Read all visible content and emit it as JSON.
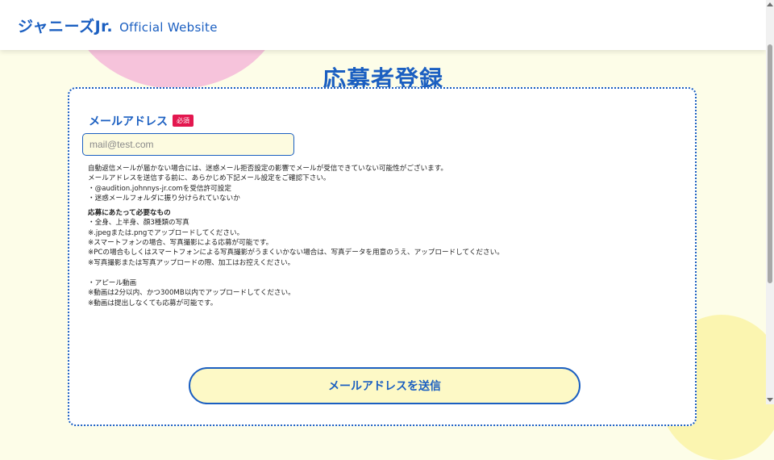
{
  "header": {
    "logo_main": "ジャニーズJr.",
    "logo_sub": "Official Website"
  },
  "page": {
    "title": "応募者登録"
  },
  "form": {
    "email_label": "メールアドレス",
    "required_badge": "必須",
    "email_placeholder": "mail@test.com",
    "email_value": "",
    "notes": {
      "line1": "自動返信メールが届かない場合には、迷惑メール拒否設定の影響でメールが受信できていない可能性がございます。",
      "line2": "メールアドレスを送信する前に、あらかじめ下記メール設定をご確認下さい。",
      "line3": "・@audition.johnnys-jr.comを受信許可設定",
      "line4": "・迷惑メールフォルダに振り分けられていないか",
      "required_heading": "応募にあたって必要なもの",
      "req1": "・全身、上半身、顔3種類の写真",
      "req2": "※.jpegまたは.pngでアップロードしてください。",
      "req3": "※スマートフォンの場合、写真撮影による応募が可能です。",
      "req4": "※PCの場合もしくはスマートフォンによる写真撮影がうまくいかない場合は、写真データを用意のうえ、アップロードしてください。",
      "req5": "※写真撮影または写真アップロードの際、加工はお控えください。",
      "video1": "・アピール動画",
      "video2": "※動画は2分以内、かつ300MB以内でアップロードしてください。",
      "video3": "※動画は提出しなくても応募が可能です。"
    },
    "submit_label": "メールアドレスを送信"
  },
  "colors": {
    "brand_blue": "#1b5fc1",
    "required_red": "#e3174f",
    "page_background": "#fdfde8",
    "button_fill": "#fdf9c6"
  }
}
